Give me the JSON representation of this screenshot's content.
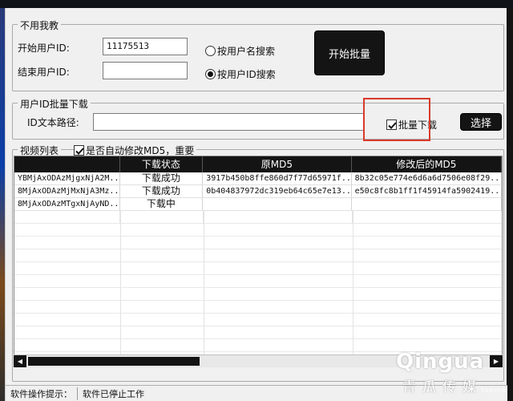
{
  "group1": {
    "legend": "不用我教",
    "start_user_label": "开始用户ID:",
    "start_user_value": "11175513",
    "end_user_label": "结束用户ID:",
    "end_user_value": "",
    "radio_name": "按用户名搜索",
    "radio_id": "按用户ID搜索",
    "selected": "radio_id",
    "start_button": "开始批量"
  },
  "group2": {
    "legend": "用户ID批量下载",
    "path_label": "ID文本路径:",
    "path_value": "",
    "batch_checkbox": "批量下载",
    "select_button": "选择"
  },
  "group3": {
    "legend": "视频列表",
    "auto_md5_checkbox": "是否自动修改MD5，重要"
  },
  "table": {
    "headers": [
      "",
      "下载状态",
      "原MD5",
      "修改后的MD5"
    ],
    "rows": [
      [
        "YBMjAxODAzMjgxNjA2M...",
        "下载成功",
        "3917b450b8ffe860d7f77d65971f...",
        "8b32c05e774e6d6a6d7506e08f29..."
      ],
      [
        "8MjAxODAzMjMxNjA3Mz...",
        "下载成功",
        "0b404837972dc319eb64c65e7e13...",
        "e50c8fc8b1ff1f45914fa5902419..."
      ],
      [
        "8MjAxODAzMTgxNjAyND...",
        "下载中",
        "",
        ""
      ]
    ]
  },
  "status": {
    "label": "软件操作提示：",
    "message": "软件已停止工作"
  },
  "watermark": {
    "logo": "Qingua",
    "name": "青瓜传媒",
    "tag": "TAOHIN"
  },
  "colors": {
    "dark_button": "#141414",
    "highlight": "#d93a2b"
  }
}
